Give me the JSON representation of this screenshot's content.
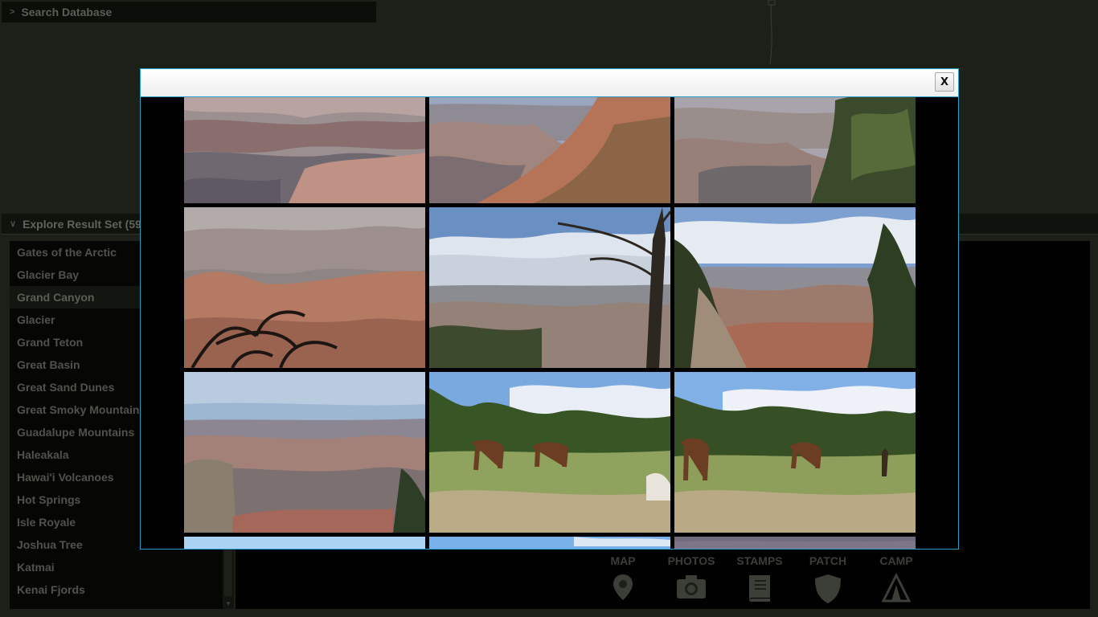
{
  "search": {
    "label": "Search Database",
    "icon": "chevron-right-icon"
  },
  "results": {
    "header": "Explore Result Set (59",
    "selected": "Grand Canyon",
    "parks": [
      "Gates of the Arctic",
      "Glacier Bay",
      "Grand Canyon",
      "Glacier",
      "Grand Teton",
      "Great Basin",
      "Great Sand Dunes",
      "Great Smoky Mountains",
      "Guadalupe Mountains",
      "Haleakala",
      "Hawai'i Volcanoes",
      "Hot Springs",
      "Isle Royale",
      "Joshua Tree",
      "Katmai",
      "Kenai Fjords"
    ]
  },
  "toolbar": {
    "map": "MAP",
    "photos": "PHOTOS",
    "stamps": "STAMPS",
    "patch": "PATCH",
    "camp": "CAMP"
  },
  "modal": {
    "close_label": "X"
  },
  "gallery": {
    "photos": [
      {
        "subject": "canyon-vista"
      },
      {
        "subject": "canyon-ridge"
      },
      {
        "subject": "canyon-pine"
      },
      {
        "subject": "canyon-dead-branch"
      },
      {
        "subject": "canyon-dead-tree"
      },
      {
        "subject": "canyon-juniper"
      },
      {
        "subject": "canyon-overlook"
      },
      {
        "subject": "elk-grazing"
      },
      {
        "subject": "elk-visitors"
      },
      {
        "subject": "partial"
      },
      {
        "subject": "partial"
      },
      {
        "subject": "partial"
      }
    ]
  }
}
